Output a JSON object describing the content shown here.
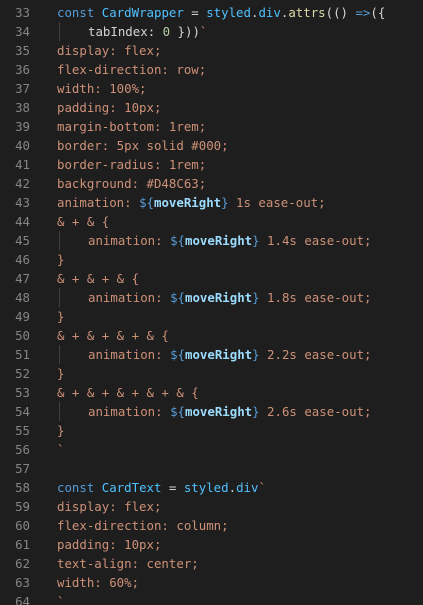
{
  "editor": {
    "lines": [
      {
        "n": "33",
        "indent": 0,
        "tokens": [
          {
            "t": "const ",
            "c": "kw"
          },
          {
            "t": "CardWrapper",
            "c": "var"
          },
          {
            "t": " = ",
            "c": "plain"
          },
          {
            "t": "styled",
            "c": "var"
          },
          {
            "t": ".",
            "c": "plain"
          },
          {
            "t": "div",
            "c": "var"
          },
          {
            "t": ".",
            "c": "plain"
          },
          {
            "t": "attrs",
            "c": "fn"
          },
          {
            "t": "(() ",
            "c": "punc"
          },
          {
            "t": "=>",
            "c": "kw"
          },
          {
            "t": "({",
            "c": "punc"
          }
        ]
      },
      {
        "n": "34",
        "indent": 1,
        "tokens": [
          {
            "t": "tabIndex",
            "c": "plain"
          },
          {
            "t": ": ",
            "c": "plain"
          },
          {
            "t": "0",
            "c": "num"
          },
          {
            "t": " }))",
            "c": "punc"
          },
          {
            "t": "`",
            "c": "str"
          }
        ]
      },
      {
        "n": "35",
        "indent": 0,
        "tokens": [
          {
            "t": "display: flex;",
            "c": "str"
          }
        ]
      },
      {
        "n": "36",
        "indent": 0,
        "tokens": [
          {
            "t": "flex-direction: row;",
            "c": "str"
          }
        ]
      },
      {
        "n": "37",
        "indent": 0,
        "tokens": [
          {
            "t": "width: 100%;",
            "c": "str"
          }
        ]
      },
      {
        "n": "38",
        "indent": 0,
        "tokens": [
          {
            "t": "padding: 10px;",
            "c": "str"
          }
        ]
      },
      {
        "n": "39",
        "indent": 0,
        "tokens": [
          {
            "t": "margin-bottom: 1rem;",
            "c": "str"
          }
        ]
      },
      {
        "n": "40",
        "indent": 0,
        "tokens": [
          {
            "t": "border: 5px solid #000;",
            "c": "str"
          }
        ]
      },
      {
        "n": "41",
        "indent": 0,
        "tokens": [
          {
            "t": "border-radius: 1rem;",
            "c": "str"
          }
        ]
      },
      {
        "n": "42",
        "indent": 0,
        "tokens": [
          {
            "t": "background: #D48C63;",
            "c": "str"
          }
        ]
      },
      {
        "n": "43",
        "indent": 0,
        "tokens": [
          {
            "t": "animation: ",
            "c": "str"
          },
          {
            "t": "${",
            "c": "tmpl"
          },
          {
            "t": "moveRight",
            "c": "interp"
          },
          {
            "t": "}",
            "c": "tmpl"
          },
          {
            "t": " 1s ease-out;",
            "c": "str"
          }
        ]
      },
      {
        "n": "44",
        "indent": 0,
        "tokens": [
          {
            "t": "& + & {",
            "c": "str"
          }
        ]
      },
      {
        "n": "45",
        "indent": 1,
        "tokens": [
          {
            "t": "animation: ",
            "c": "str"
          },
          {
            "t": "${",
            "c": "tmpl"
          },
          {
            "t": "moveRight",
            "c": "interp"
          },
          {
            "t": "}",
            "c": "tmpl"
          },
          {
            "t": " 1.4s ease-out;",
            "c": "str"
          }
        ]
      },
      {
        "n": "46",
        "indent": 0,
        "tokens": [
          {
            "t": "}",
            "c": "str"
          }
        ]
      },
      {
        "n": "47",
        "indent": 0,
        "tokens": [
          {
            "t": "& + & + & {",
            "c": "str"
          }
        ]
      },
      {
        "n": "48",
        "indent": 1,
        "tokens": [
          {
            "t": "animation: ",
            "c": "str"
          },
          {
            "t": "${",
            "c": "tmpl"
          },
          {
            "t": "moveRight",
            "c": "interp"
          },
          {
            "t": "}",
            "c": "tmpl"
          },
          {
            "t": " 1.8s ease-out;",
            "c": "str"
          }
        ]
      },
      {
        "n": "49",
        "indent": 0,
        "tokens": [
          {
            "t": "}",
            "c": "str"
          }
        ]
      },
      {
        "n": "50",
        "indent": 0,
        "tokens": [
          {
            "t": "& + & + & + & {",
            "c": "str"
          }
        ]
      },
      {
        "n": "51",
        "indent": 1,
        "tokens": [
          {
            "t": "animation: ",
            "c": "str"
          },
          {
            "t": "${",
            "c": "tmpl"
          },
          {
            "t": "moveRight",
            "c": "interp"
          },
          {
            "t": "}",
            "c": "tmpl"
          },
          {
            "t": " 2.2s ease-out;",
            "c": "str"
          }
        ]
      },
      {
        "n": "52",
        "indent": 0,
        "tokens": [
          {
            "t": "}",
            "c": "str"
          }
        ]
      },
      {
        "n": "53",
        "indent": 0,
        "tokens": [
          {
            "t": "& + & + & + & + & {",
            "c": "str"
          }
        ]
      },
      {
        "n": "54",
        "indent": 1,
        "tokens": [
          {
            "t": "animation: ",
            "c": "str"
          },
          {
            "t": "${",
            "c": "tmpl"
          },
          {
            "t": "moveRight",
            "c": "interp"
          },
          {
            "t": "}",
            "c": "tmpl"
          },
          {
            "t": " 2.6s ease-out;",
            "c": "str"
          }
        ]
      },
      {
        "n": "55",
        "indent": 0,
        "tokens": [
          {
            "t": "}",
            "c": "str"
          }
        ]
      },
      {
        "n": "56",
        "indent": 0,
        "tokens": [
          {
            "t": "`",
            "c": "str"
          }
        ]
      },
      {
        "n": "57",
        "indent": 0,
        "tokens": []
      },
      {
        "n": "58",
        "indent": 0,
        "tokens": [
          {
            "t": "const ",
            "c": "kw"
          },
          {
            "t": "CardText",
            "c": "var"
          },
          {
            "t": " = ",
            "c": "plain"
          },
          {
            "t": "styled",
            "c": "var"
          },
          {
            "t": ".",
            "c": "plain"
          },
          {
            "t": "div",
            "c": "var"
          },
          {
            "t": "`",
            "c": "str"
          }
        ]
      },
      {
        "n": "59",
        "indent": 0,
        "tokens": [
          {
            "t": "display: flex;",
            "c": "str"
          }
        ]
      },
      {
        "n": "60",
        "indent": 0,
        "tokens": [
          {
            "t": "flex-direction: column;",
            "c": "str"
          }
        ]
      },
      {
        "n": "61",
        "indent": 0,
        "tokens": [
          {
            "t": "padding: 10px;",
            "c": "str"
          }
        ]
      },
      {
        "n": "62",
        "indent": 0,
        "tokens": [
          {
            "t": "text-align: center;",
            "c": "str"
          }
        ]
      },
      {
        "n": "63",
        "indent": 0,
        "tokens": [
          {
            "t": "width: 60%;",
            "c": "str"
          }
        ]
      },
      {
        "n": "64",
        "indent": 0,
        "tokens": [
          {
            "t": "`",
            "c": "str"
          }
        ]
      }
    ]
  }
}
